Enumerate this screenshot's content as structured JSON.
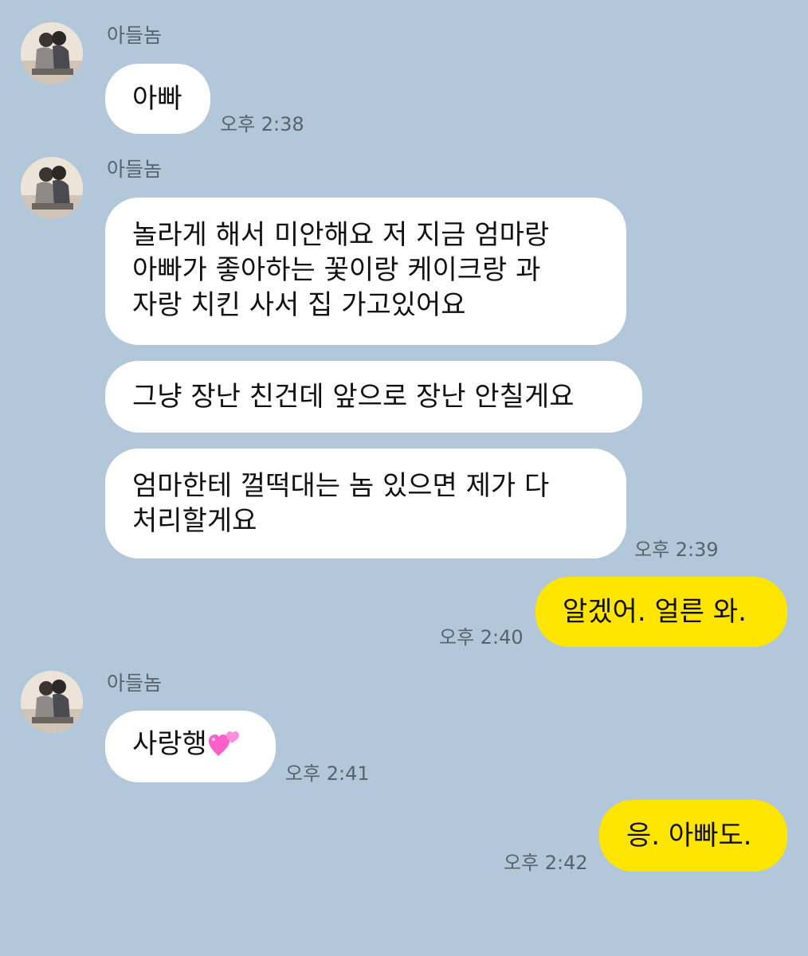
{
  "chat": {
    "background": "#b2c7d9",
    "incoming_bubble_color": "#ffffff",
    "outgoing_bubble_color": "#fee500",
    "groups": [
      {
        "sender": "아들놈",
        "messages": [
          {
            "lines": [
              "아빠"
            ]
          }
        ],
        "time": "오후 2:38"
      },
      {
        "sender": "아들놈",
        "messages": [
          {
            "lines": [
              "놀라게 해서 미안해요 저 지금 엄마랑",
              "아빠가 좋아하는 꽃이랑 케이크랑 과",
              "자랑 치킨 사서 집 가고있어요"
            ]
          },
          {
            "lines": [
              "그냥 장난 친건데 앞으로 장난 안칠게요"
            ]
          },
          {
            "lines": [
              "엄마한테 껄떡대는 놈 있으면 제가 다",
              "처리할게요"
            ]
          }
        ],
        "time": "오후 2:39"
      },
      {
        "outgoing": true,
        "messages": [
          {
            "lines": [
              "알겠어. 얼른 와."
            ]
          }
        ],
        "time": "오후 2:40"
      },
      {
        "sender": "아들놈",
        "messages": [
          {
            "lines": [
              "사랑행"
            ],
            "emoji": "two-hearts-icon"
          }
        ],
        "time": "오후 2:41"
      },
      {
        "outgoing": true,
        "messages": [
          {
            "lines": [
              "응. 아빠도."
            ]
          }
        ],
        "time": "오후 2:42"
      }
    ]
  }
}
